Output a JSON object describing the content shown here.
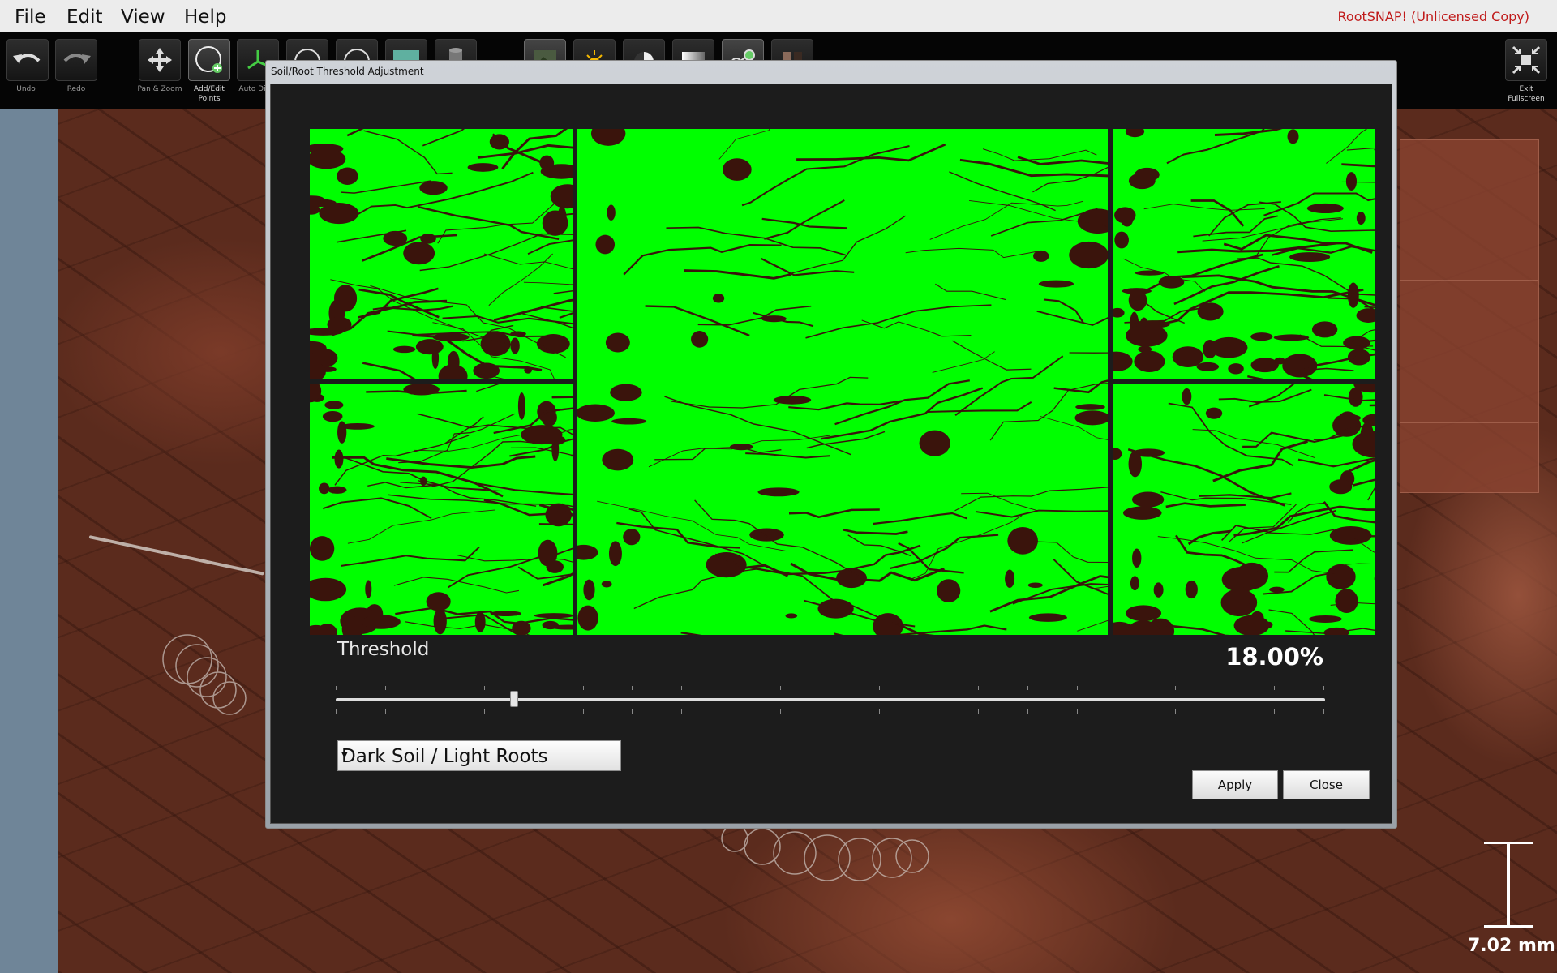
{
  "menu": {
    "items": [
      "File",
      "Edit",
      "View",
      "Help"
    ],
    "license_text": "RootSNAP!  (Unlicensed Copy)"
  },
  "toolbar": {
    "undo_label": "Undo",
    "redo_label": "Redo",
    "pan_zoom_label": "Pan & Zoom",
    "add_edit_points_label": "Add/Edit\nPoints",
    "auto_label": "Auto Di",
    "exit_fullscreen_label": "Exit\nFullscreen",
    "icons": [
      "undo-icon",
      "redo-icon",
      "pan-zoom-icon",
      "add-point-icon",
      "auto-detect-icon",
      "circle-tool-icon",
      "circle-tool-icon",
      "color-swatch-icon",
      "cylinder-icon",
      "image-icon",
      "brightness-icon",
      "contrast-icon",
      "gradient-icon",
      "link-points-icon",
      "grid-icon",
      "exit-fullscreen-icon"
    ]
  },
  "dialog": {
    "title": "Soil/Root Threshold Adjustment",
    "threshold_label": "Threshold",
    "threshold_value": "18.00%",
    "threshold_fraction": 0.18,
    "mode_select": "Dark Soil / Light Roots",
    "apply_label": "Apply",
    "close_label": "Close",
    "mask_color": "#00ff00"
  },
  "scale_bar": {
    "label": "7.02 mm"
  }
}
